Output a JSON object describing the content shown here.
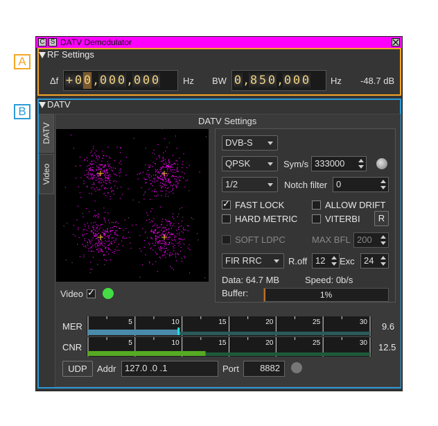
{
  "annotations": {
    "a": "A",
    "b": "B"
  },
  "window": {
    "title": "DATV Demodulator",
    "btn_c": "C",
    "btn_s": "S"
  },
  "rf": {
    "header": "RF Settings",
    "df_label": "Δf",
    "df_digits": [
      "+",
      "0",
      "0",
      ",",
      "0",
      "0",
      "0",
      ",",
      "0",
      "0",
      "0"
    ],
    "df_unit": "Hz",
    "bw_label": "BW",
    "bw_digits": [
      "0",
      ",",
      "8",
      "5",
      "0",
      ",",
      "0",
      "0",
      "0"
    ],
    "bw_unit": "Hz",
    "power": "-48.7 dB"
  },
  "datv": {
    "header": "DATV",
    "tabs": [
      "DATV",
      "Video"
    ],
    "settings_title": "DATV Settings",
    "standard": "DVB-S",
    "modulation": "QPSK",
    "symrate_label": "Sym/s",
    "symrate": "333000",
    "fec": "1/2",
    "notch_label": "Notch filter",
    "notch": "0",
    "fast_lock": "FAST LOCK",
    "allow_drift": "ALLOW DRIFT",
    "hard_metric": "HARD METRIC",
    "viterbi": "VITERBI",
    "r_button": "R",
    "soft_ldpc": "SOFT LDPC",
    "max_bfl_label": "MAX BFL",
    "max_bfl": "200",
    "filter": "FIR RRC",
    "roff_label": "R.off",
    "roff": "12",
    "exc_label": "Exc",
    "exc": "24",
    "data_text": "Data: 64.7 MB",
    "speed_text": "Speed: 0b/s",
    "buffer_label": "Buffer:",
    "buffer_text": "1%",
    "buffer_fraction": 0.01,
    "video_label": "Video",
    "mer_label": "MER",
    "mer_value": "9.6",
    "mer_level": 9.6,
    "cnr_label": "CNR",
    "cnr_value": "12.5",
    "cnr_level": 12.5,
    "scale_ticks": [
      "5",
      "10",
      "15",
      "20",
      "25",
      "30"
    ],
    "udp_button": "UDP",
    "addr_label": "Addr",
    "addr": "127.0  .0  .1",
    "port_label": "Port",
    "port": "8882"
  },
  "colors": {
    "title_bar": "#ff00ff",
    "section_a": "#f5a623",
    "section_b": "#2a9bd8",
    "constellation": "#ff00ff",
    "cross": "#f0c020",
    "video_indicator": "#44dd44",
    "mer_bar": "#4a8aaa",
    "cnr_bar": "#55aa22"
  }
}
